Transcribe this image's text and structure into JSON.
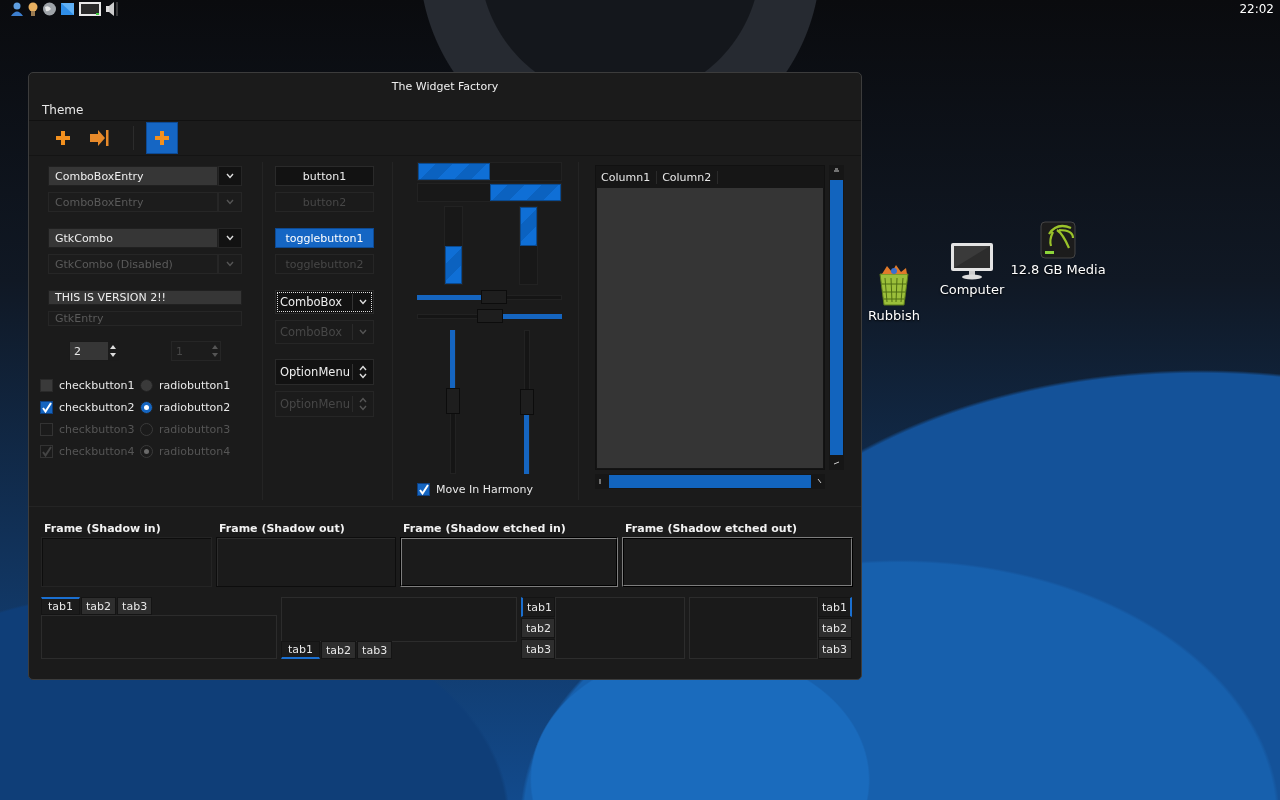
{
  "panel": {
    "clock": "22:02"
  },
  "window": {
    "title": "The Widget Factory"
  },
  "menu": [
    {
      "label": "Theme"
    }
  ],
  "toolbar": [
    {
      "kind": "add",
      "selected": false
    },
    {
      "kind": "forward",
      "selected": false
    },
    {
      "kind": "add",
      "selected": true
    }
  ],
  "entries": [
    {
      "kind": "combo-entry",
      "value": "ComboBoxEntry",
      "disabled": false
    },
    {
      "kind": "combo-entry",
      "value": "ComboBoxEntry",
      "disabled": true
    },
    {
      "kind": "combo",
      "value": "GtkCombo",
      "disabled": false
    },
    {
      "kind": "combo",
      "value": "GtkCombo (Disabled)",
      "disabled": true
    },
    {
      "kind": "entry",
      "value": "THIS IS VERSION 2!!",
      "disabled": false
    },
    {
      "kind": "entry",
      "value": "GtkEntry",
      "disabled": true
    }
  ],
  "spins": [
    {
      "value": "2",
      "disabled": false
    },
    {
      "value": "1",
      "disabled": true
    }
  ],
  "checks": [
    {
      "label": "checkbutton1",
      "checked": false,
      "disabled": false
    },
    {
      "label": "checkbutton2",
      "checked": true,
      "disabled": false
    },
    {
      "label": "checkbutton3",
      "checked": false,
      "disabled": true
    },
    {
      "label": "checkbutton4",
      "checked": true,
      "disabled": true
    }
  ],
  "radios": [
    {
      "label": "radiobutton1",
      "selected": false,
      "disabled": false
    },
    {
      "label": "radiobutton2",
      "selected": true,
      "disabled": false
    },
    {
      "label": "radiobutton3",
      "selected": false,
      "disabled": true
    },
    {
      "label": "radiobutton4",
      "selected": true,
      "disabled": true
    }
  ],
  "buttons": [
    {
      "label": "button1",
      "on": false,
      "disabled": false
    },
    {
      "label": "button2",
      "on": false,
      "disabled": true
    },
    {
      "label": "togglebutton1",
      "on": true,
      "disabled": false
    },
    {
      "label": "togglebutton2",
      "on": false,
      "disabled": true
    }
  ],
  "combos": [
    {
      "kind": "combobox",
      "value": "ComboBox",
      "focused": true,
      "disabled": false
    },
    {
      "kind": "combobox",
      "value": "ComboBox",
      "focused": false,
      "disabled": true
    },
    {
      "kind": "option-menu",
      "value": "OptionMenu",
      "focused": false,
      "disabled": false
    },
    {
      "kind": "option-menu",
      "value": "OptionMenu",
      "focused": false,
      "disabled": true
    }
  ],
  "progress_bars": {
    "horizontal": [
      {
        "inverted": false,
        "level": 0.5
      },
      {
        "inverted": true,
        "level": 0.5
      }
    ],
    "vertical": [
      {
        "inverted": false,
        "level": 0.5
      },
      {
        "inverted": true,
        "level": 0.5
      }
    ]
  },
  "scales": {
    "horizontal": [
      {
        "inverted": false,
        "level": 0.53
      },
      {
        "inverted": true,
        "level": 0.5
      }
    ],
    "vertical": [
      {
        "inverted": false,
        "level": 0.49
      },
      {
        "inverted": true,
        "level": 0.5
      }
    ]
  },
  "harmony": {
    "label": "Move In Harmony",
    "checked": true
  },
  "tree": {
    "columns": [
      "Column1",
      "Column2"
    ]
  },
  "frames": [
    {
      "label": "Frame (Shadow in)",
      "kind": "in"
    },
    {
      "label": "Frame (Shadow out)",
      "kind": "out"
    },
    {
      "label": "Frame (Shadow etched in)",
      "kind": "etched"
    },
    {
      "label": "Frame (Shadow etched out)",
      "kind": "ridge"
    }
  ],
  "notebooks": [
    {
      "kind": "top",
      "tabs": [
        {
          "label": "tab1",
          "selected": true
        },
        {
          "label": "tab2",
          "selected": false
        },
        {
          "label": "tab3",
          "selected": false
        }
      ]
    },
    {
      "kind": "bottom",
      "tabs": [
        {
          "label": "tab1",
          "selected": true
        },
        {
          "label": "tab2",
          "selected": false
        },
        {
          "label": "tab3",
          "selected": false
        }
      ]
    },
    {
      "kind": "left",
      "tabs": [
        {
          "label": "tab1",
          "selected": true
        },
        {
          "label": "tab2",
          "selected": false
        },
        {
          "label": "tab3",
          "selected": false
        }
      ]
    },
    {
      "kind": "right",
      "tabs": [
        {
          "label": "tab1",
          "selected": true
        },
        {
          "label": "tab2",
          "selected": false
        },
        {
          "label": "tab3",
          "selected": false
        }
      ]
    }
  ],
  "desktop_icons": [
    {
      "kind": "trash",
      "label": "Rubbish"
    },
    {
      "kind": "computer",
      "label": "Computer"
    },
    {
      "kind": "drive",
      "label": "12.8 GB Media"
    }
  ]
}
